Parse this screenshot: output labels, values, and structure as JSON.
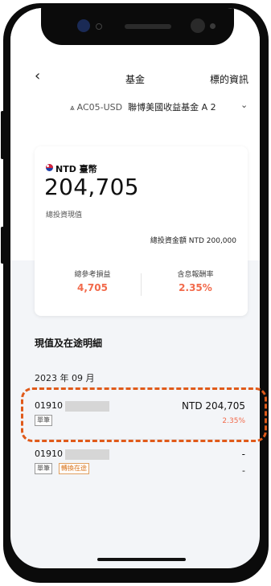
{
  "header": {
    "back_glyph": "‹",
    "title": "基金",
    "link": "標的資訊"
  },
  "fund": {
    "icon": "fund-icon",
    "code": "AC05-USD",
    "name": "聯博美國收益基金 A 2"
  },
  "summary": {
    "currency": "NTD 臺幣",
    "total_value": "204,705",
    "total_label": "總投資現值",
    "invested_label": "總投資金額",
    "invested_value": "NTD 200,000",
    "pnl_label": "總參考損益",
    "pnl_value": "4,705",
    "return_label": "含息報酬率",
    "return_value": "2.35%"
  },
  "details": {
    "title": "現值及在途明細",
    "month": "2023 年 09 月",
    "rows": [
      {
        "account": "01910",
        "amount": "NTD 204,705",
        "pct": "2.35%",
        "tags": [
          "單筆"
        ]
      },
      {
        "account": "01910",
        "amount": "-",
        "pct": "-",
        "tags": [
          "單筆",
          "轉換在途"
        ]
      }
    ]
  },
  "colors": {
    "accent": "#f26a4b",
    "highlight": "#e05a1a"
  }
}
